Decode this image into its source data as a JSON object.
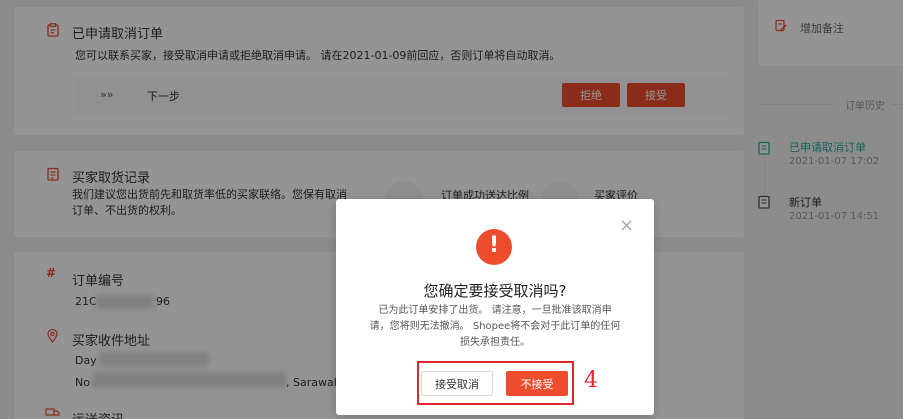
{
  "cancel_request": {
    "title": "已申请取消订单",
    "description": "您可以联系买家，接受取消申请或拒绝取消申请。 请在2021-01-09前回应，否则订单将自动取消。",
    "next_step_label": "下一步",
    "reject_label": "拒绝",
    "accept_label": "接受"
  },
  "pickup_record": {
    "title": "买家取货记录",
    "description_line1": "我们建议您出货前先和取货率低的买家联络。您保有取消",
    "description_line2": "订单、不出货的权利。",
    "success_ratio_label": "订单成功送达比例",
    "rating_label": "买家评价"
  },
  "order_info": {
    "order_number_label": "订单编号",
    "order_number_prefix": "21C",
    "order_number_suffix": "96",
    "address_label": "买家收件地址",
    "address_line1_prefix": "Day",
    "address_line2_prefix": "No",
    "address_line2_suffix": ", Sarawal",
    "shipping_label": "运送资讯"
  },
  "sidebar": {
    "add_note_label": "增加备注",
    "history_title": "订单历史",
    "history": [
      {
        "title": "已申请取消订单",
        "time": "2021-01-07 17:02",
        "active": true
      },
      {
        "title": "新订单",
        "time": "2021-01-07 14:51",
        "active": false
      }
    ]
  },
  "modal": {
    "title": "您确定要接受取消吗?",
    "message_line1": "已为此订单安排了出货。 请注意，一旦批准该取消申",
    "message_line2": "请，您将则无法撤消。 Shopee将不会对于此订单的任何",
    "message_line3": "损失承担责任。",
    "accept_cancel_label": "接受取消",
    "reject_label": "不接受",
    "close_symbol": "×",
    "alert_symbol": "!"
  },
  "annotation": {
    "number": "4"
  },
  "colors": {
    "brand": "#ee4d2d",
    "success": "#26aa99",
    "annotation": "#e0262c"
  }
}
